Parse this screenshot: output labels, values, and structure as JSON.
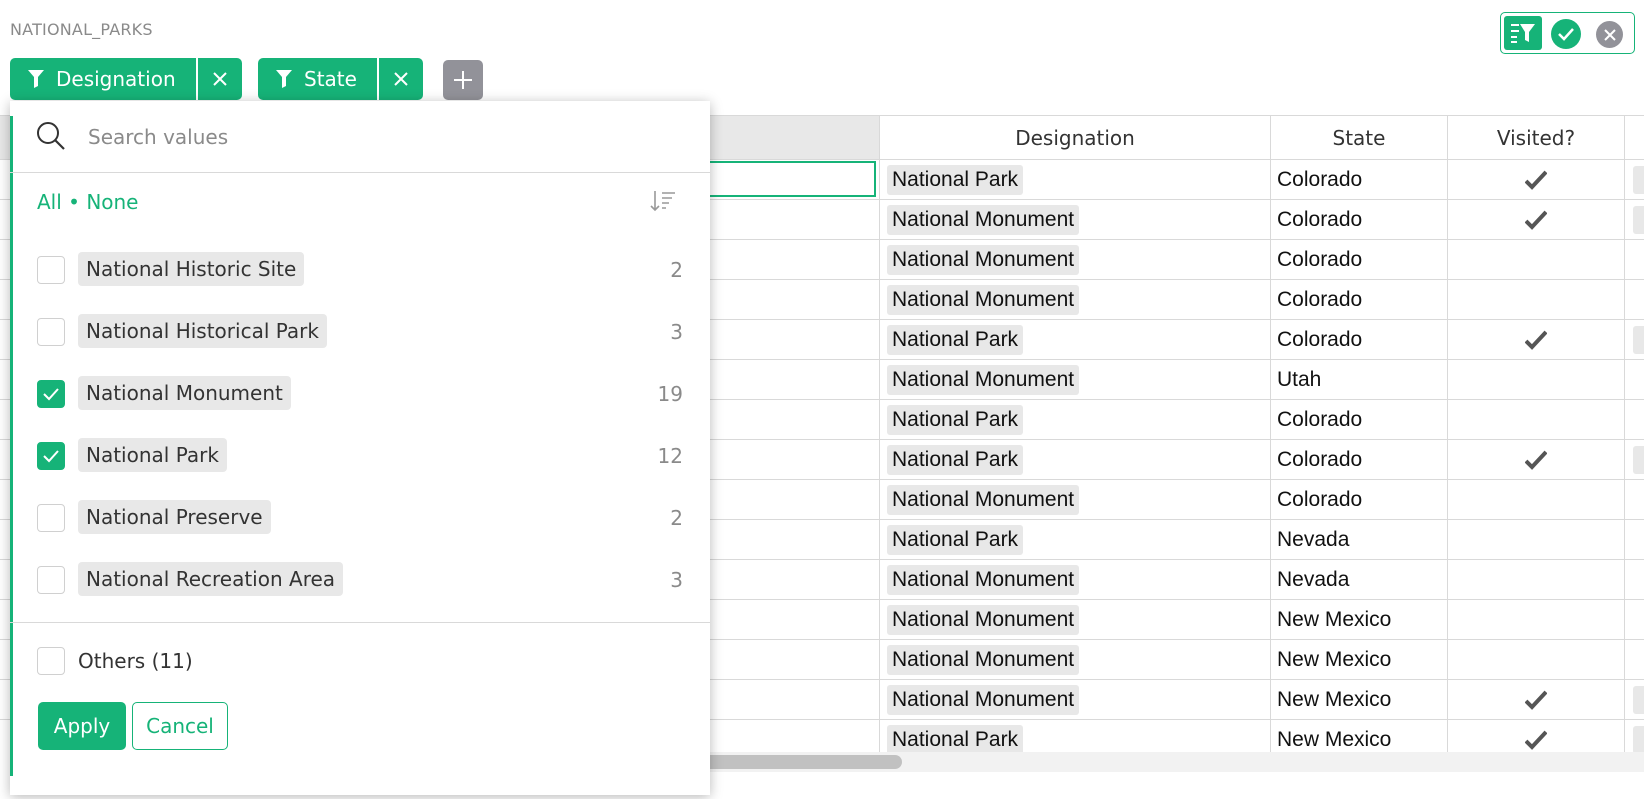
{
  "table_title": "NATIONAL_PARKS",
  "filter_chips": [
    {
      "label": "Designation"
    },
    {
      "label": "State"
    }
  ],
  "columns": [
    "Designation",
    "State",
    "Visited?"
  ],
  "rows": [
    {
      "designation": "National Park",
      "state": "Colorado",
      "visited": true
    },
    {
      "designation": "National Monument",
      "state": "Colorado",
      "visited": true
    },
    {
      "designation": "National Monument",
      "state": "Colorado",
      "visited": false
    },
    {
      "designation": "National Monument",
      "state": "Colorado",
      "visited": false
    },
    {
      "designation": "National Park",
      "state": "Colorado",
      "visited": true
    },
    {
      "designation": "National Monument",
      "state": "Utah",
      "visited": false
    },
    {
      "designation": "National Park",
      "state": "Colorado",
      "visited": false
    },
    {
      "designation": "National Park",
      "state": "Colorado",
      "visited": true
    },
    {
      "designation": "National Monument",
      "state": "Colorado",
      "visited": false
    },
    {
      "designation": "National Park",
      "state": "Nevada",
      "visited": false
    },
    {
      "designation": "National Monument",
      "state": "Nevada",
      "visited": false
    },
    {
      "designation": "National Monument",
      "state": "New Mexico",
      "visited": false
    },
    {
      "designation": "National Monument",
      "state": "New Mexico",
      "visited": false
    },
    {
      "designation": "National Monument",
      "state": "New Mexico",
      "visited": true
    },
    {
      "designation": "National Park",
      "state": "New Mexico",
      "visited": true
    }
  ],
  "filter_popup": {
    "search_placeholder": "Search values",
    "all_label": "All",
    "separator": "•",
    "none_label": "None",
    "values": [
      {
        "label": "National Historic Site",
        "count": "2",
        "checked": false
      },
      {
        "label": "National Historical Park",
        "count": "3",
        "checked": false
      },
      {
        "label": "National Monument",
        "count": "19",
        "checked": true
      },
      {
        "label": "National Park",
        "count": "12",
        "checked": true
      },
      {
        "label": "National Preserve",
        "count": "2",
        "checked": false
      },
      {
        "label": "National Recreation Area",
        "count": "3",
        "checked": false
      }
    ],
    "others_label": "Others (11)",
    "apply_label": "Apply",
    "cancel_label": "Cancel"
  },
  "colors": {
    "accent": "#16b378",
    "chip_gray": "#929299",
    "choice_bg": "#e8e8e8"
  }
}
